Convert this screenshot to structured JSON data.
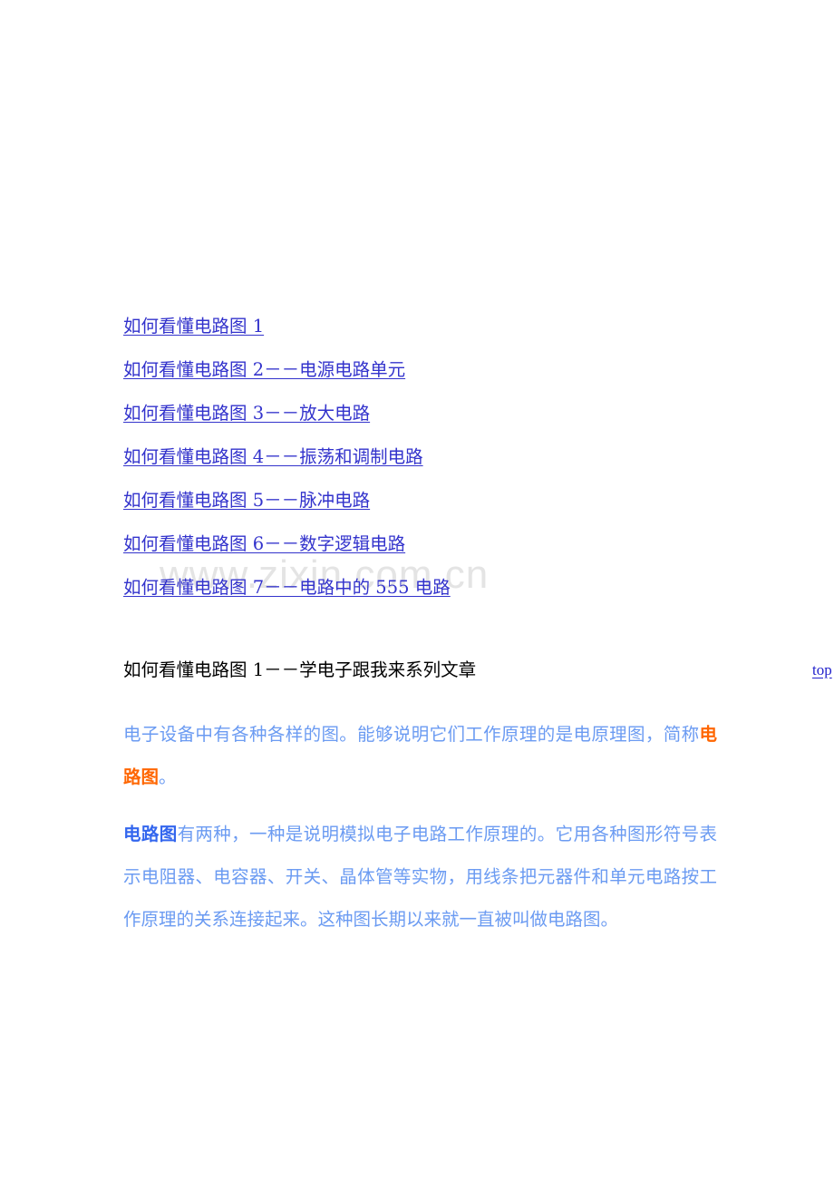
{
  "document": {
    "watermark": "www.zixin.com.cn",
    "toc": {
      "links": [
        {
          "label": "如何看懂电路图 1"
        },
        {
          "label": "如何看懂电路图 2－－电源电路单元"
        },
        {
          "label": "如何看懂电路图 3－－放大电路"
        },
        {
          "label": "如何看懂电路图 4－－振荡和调制电路"
        },
        {
          "label": "如何看懂电路图 5－－脉冲电路"
        },
        {
          "label": "如何看懂电路图 6－－数字逻辑电路"
        },
        {
          "label": "如何看懂电路图 7－－电路中的 555 电路"
        }
      ]
    },
    "section": {
      "title": "如何看懂电路图 1－－学电子跟我来系列文章",
      "top_link": "top"
    },
    "paragraphs": [
      {
        "id": "p1",
        "runs": [
          {
            "text": "电子设备中有各种各样的图。能够说明它们工作原理的是电原理图，简称",
            "style": "normal"
          },
          {
            "text": "电路图",
            "style": "orange-bold"
          },
          {
            "text": "。",
            "style": "normal"
          }
        ]
      },
      {
        "id": "p2",
        "runs": [
          {
            "text": "电路图",
            "style": "blue-bold"
          },
          {
            "text": "有两种，一种是说明模拟电子电路工作原理的。它用各种图形符号表示电阻器、电容器、开关、晶体管等实物，用线条把元器件和单元电路按工作原理的关系连接起来。这种图长期以来就一直被叫做电路图。",
            "style": "normal"
          }
        ]
      }
    ],
    "colors": {
      "link": "#3333CC",
      "body_text": "#6B9BF2",
      "keyword_orange": "#FF6600",
      "keyword_blue": "#3366EE",
      "heading": "#000000",
      "watermark": "#E4E4E4",
      "page_background": "#FFFFFF"
    }
  }
}
